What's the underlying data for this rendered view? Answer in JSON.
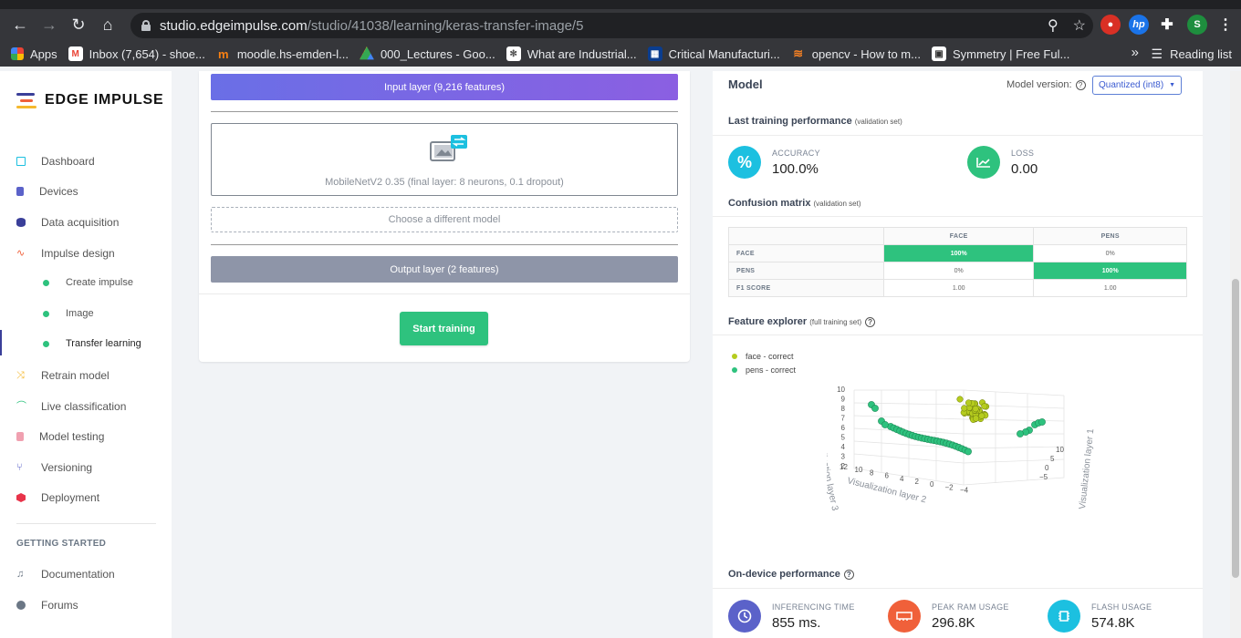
{
  "browser": {
    "url_host": "studio.edgeimpulse.com",
    "url_path": "/studio/41038/learning/keras-transfer-image/5",
    "profile_initial": "S",
    "bookmarks": [
      {
        "label": "Apps",
        "icon": "apps-grid-icon"
      },
      {
        "label": "Inbox (7,654) - shoe...",
        "icon": "gmail-icon"
      },
      {
        "label": "moodle.hs-emden-l...",
        "icon": "moodle-icon"
      },
      {
        "label": "000_Lectures - Goo...",
        "icon": "google-drive-icon"
      },
      {
        "label": "What are Industrial...",
        "icon": "page-icon"
      },
      {
        "label": "Critical Manufacturi...",
        "icon": "page-icon"
      },
      {
        "label": "opencv - How to m...",
        "icon": "stackoverflow-icon"
      },
      {
        "label": "Symmetry | Free Ful...",
        "icon": "page-icon"
      }
    ],
    "reading_list": "Reading list"
  },
  "sidebar": {
    "brand": "EDGE IMPULSE",
    "items": [
      {
        "label": "Dashboard"
      },
      {
        "label": "Devices"
      },
      {
        "label": "Data acquisition"
      },
      {
        "label": "Impulse design"
      },
      {
        "label": "Create impulse"
      },
      {
        "label": "Image"
      },
      {
        "label": "Transfer learning"
      },
      {
        "label": "Retrain model"
      },
      {
        "label": "Live classification"
      },
      {
        "label": "Model testing"
      },
      {
        "label": "Versioning"
      },
      {
        "label": "Deployment"
      }
    ],
    "section_title": "GETTING STARTED",
    "getting_started": [
      {
        "label": "Documentation"
      },
      {
        "label": "Forums"
      }
    ]
  },
  "network": {
    "input_layer": "Input layer (9,216 features)",
    "model_label": "MobileNetV2 0.35 (final layer: 8 neurons, 0.1 dropout)",
    "choose_model": "Choose a different model",
    "output_layer": "Output layer (2 features)",
    "start_training": "Start training"
  },
  "model": {
    "title": "Model",
    "version_label": "Model version:",
    "version_value": "Quantized (int8)",
    "last_training": "Last training performance",
    "validation_set": "(validation set)",
    "accuracy_label": "ACCURACY",
    "accuracy_value": "100.0%",
    "loss_label": "LOSS",
    "loss_value": "0.00",
    "confusion_title": "Confusion matrix",
    "confusion": {
      "columns": [
        "FACE",
        "PENS"
      ],
      "rows": [
        {
          "label": "FACE",
          "cells": [
            "100%",
            "0%"
          ]
        },
        {
          "label": "PENS",
          "cells": [
            "0%",
            "100%"
          ]
        },
        {
          "label": "F1 SCORE",
          "cells": [
            "1.00",
            "1.00"
          ]
        }
      ]
    },
    "feature_title": "Feature explorer",
    "full_training_set": "(full training set)",
    "legend": [
      {
        "label": "face - correct",
        "color": "#b5cc1e"
      },
      {
        "label": "pens - correct",
        "color": "#2ec27e"
      }
    ],
    "axis_labels": {
      "layer1": "Visualization layer 1",
      "layer2": "Visualization layer 2",
      "layer3": "Visualization layer 3"
    },
    "ticks_z": [
      "10",
      "9",
      "8",
      "7",
      "6",
      "5",
      "4",
      "3",
      "2"
    ],
    "ticks_y": [
      "12",
      "10",
      "8",
      "6",
      "4",
      "2",
      "0",
      "−2",
      "−4"
    ],
    "ticks_x": [
      "10",
      "5",
      "0",
      "−5"
    ],
    "on_device_title": "On-device performance",
    "inferencing_label": "INFERENCING TIME",
    "inferencing_value": "855 ms.",
    "ram_label": "PEAK RAM USAGE",
    "ram_value": "296.8K",
    "flash_label": "FLASH USAGE",
    "flash_value": "574.8K"
  },
  "colors": {
    "accent_green": "#2ec27e",
    "accent_teal": "#1cc0e0",
    "accent_red": "#f0603a",
    "accent_indigo": "#5b62c9"
  }
}
